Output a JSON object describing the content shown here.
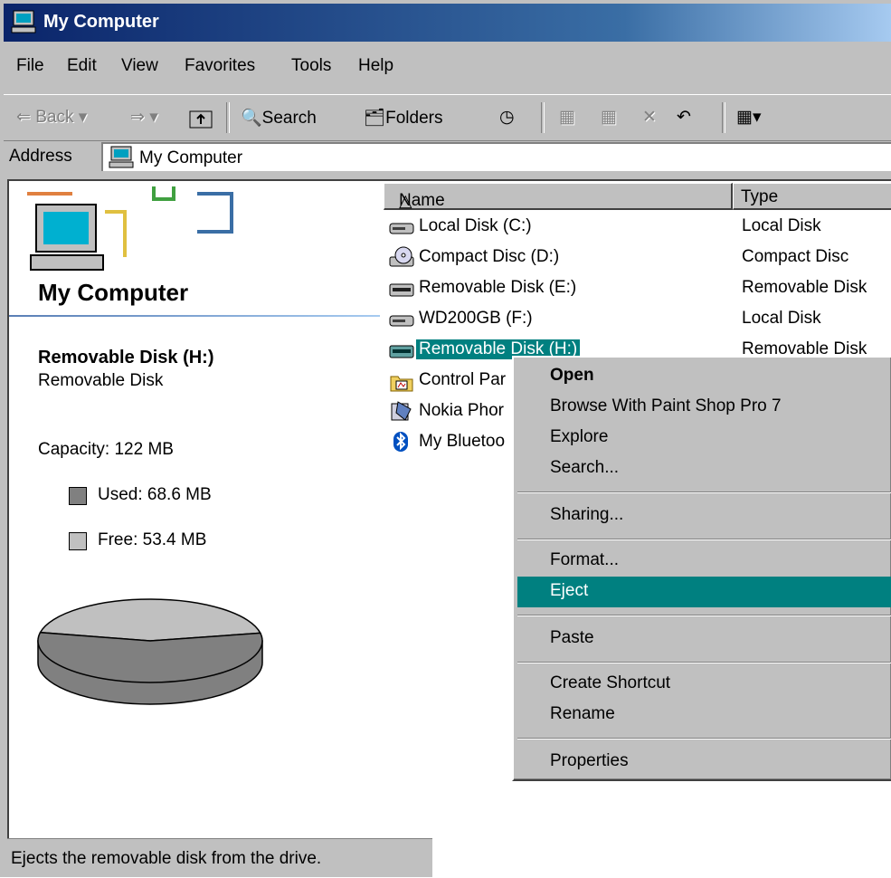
{
  "window": {
    "title": "My Computer",
    "icon": "my-computer-icon"
  },
  "menu": [
    "File",
    "Edit",
    "View",
    "Favorites",
    "Tools",
    "Help"
  ],
  "toolbar": {
    "back": "Back",
    "search": "Search",
    "folders": "Folders"
  },
  "address": {
    "label": "Address",
    "value": "My Computer"
  },
  "left_pane": {
    "title": "My Computer",
    "selected_name": "Removable Disk (H:)",
    "selected_type": "Removable Disk",
    "capacity": "Capacity: 122 MB",
    "used": "Used: 68.6 MB",
    "free": "Free: 53.4 MB",
    "used_color": "#808080",
    "free_color": "#c0c0c0"
  },
  "chart_data": {
    "type": "pie",
    "categories": [
      "Used",
      "Free"
    ],
    "values": [
      68.6,
      53.4
    ],
    "title": ""
  },
  "columns": [
    "Name",
    "Type"
  ],
  "files": [
    {
      "name": "Local Disk (C:)",
      "type": "Local Disk",
      "icon": "hard-drive-icon"
    },
    {
      "name": "Compact Disc (D:)",
      "type": "Compact Disc",
      "icon": "cd-drive-icon"
    },
    {
      "name": "Removable Disk (E:)",
      "type": "Removable Disk",
      "icon": "removable-drive-icon"
    },
    {
      "name": "WD200GB (F:)",
      "type": "Local Disk",
      "icon": "hard-drive-icon"
    },
    {
      "name": "Removable Disk (H:)",
      "type": "Removable Disk",
      "icon": "removable-drive-icon"
    },
    {
      "name": "Control Par",
      "type": "",
      "icon": "control-panel-icon"
    },
    {
      "name": "Nokia Phor",
      "type": "",
      "icon": "phone-icon"
    },
    {
      "name": "My Bluetoo",
      "type": "",
      "icon": "bluetooth-icon"
    }
  ],
  "context_menu": {
    "open": "Open",
    "browse": "Browse With Paint Shop Pro 7",
    "explore": "Explore",
    "search": "Search...",
    "sharing": "Sharing...",
    "format": "Format...",
    "eject": "Eject",
    "paste": "Paste",
    "shortcut": "Create Shortcut",
    "rename": "Rename",
    "properties": "Properties"
  },
  "status": "Ejects the removable disk from the drive.",
  "colors": {
    "title_bar": "#0a246a",
    "selection": "#008080",
    "face": "#c0c0c0"
  }
}
